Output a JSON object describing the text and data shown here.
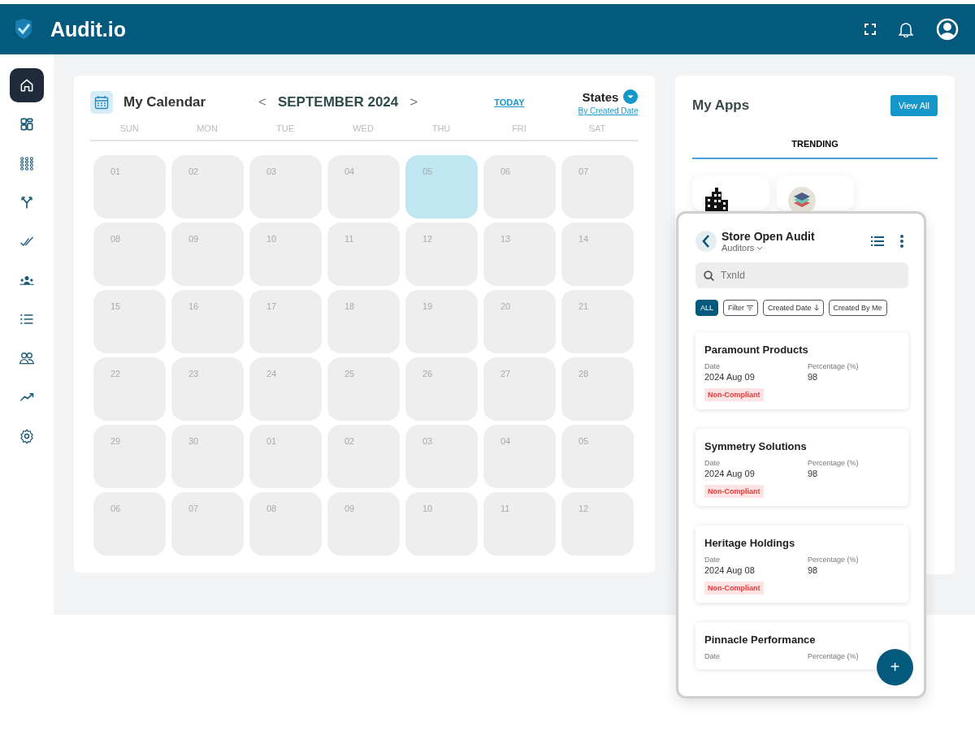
{
  "header": {
    "brand": "Audit.io"
  },
  "sidebar": {
    "items": [
      {
        "selected": true
      },
      {
        "selected": false
      },
      {
        "selected": false
      },
      {
        "selected": false
      },
      {
        "selected": false
      },
      {
        "selected": false
      },
      {
        "selected": false
      },
      {
        "selected": false
      },
      {
        "selected": false
      },
      {
        "selected": false
      }
    ]
  },
  "calendar": {
    "title": "My Calendar",
    "prev": "<",
    "month": "SEPTEMBER 2024",
    "next": ">",
    "today_link": "TODAY",
    "states_label": "States",
    "states_sub": "By Created Date",
    "weekdays": [
      "SUN",
      "MON",
      "TUE",
      "WED",
      "THU",
      "FRI",
      "SAT"
    ],
    "days": [
      {
        "label": "01",
        "selected": false
      },
      {
        "label": "02",
        "selected": false
      },
      {
        "label": "03",
        "selected": false
      },
      {
        "label": "04",
        "selected": false
      },
      {
        "label": "05",
        "selected": true
      },
      {
        "label": "06",
        "selected": false
      },
      {
        "label": "07",
        "selected": false
      },
      {
        "label": "08",
        "selected": false
      },
      {
        "label": "09",
        "selected": false
      },
      {
        "label": "10",
        "selected": false
      },
      {
        "label": "11",
        "selected": false
      },
      {
        "label": "12",
        "selected": false
      },
      {
        "label": "13",
        "selected": false
      },
      {
        "label": "14",
        "selected": false
      },
      {
        "label": "15",
        "selected": false
      },
      {
        "label": "16",
        "selected": false
      },
      {
        "label": "17",
        "selected": false
      },
      {
        "label": "18",
        "selected": false
      },
      {
        "label": "19",
        "selected": false
      },
      {
        "label": "20",
        "selected": false
      },
      {
        "label": "21",
        "selected": false
      },
      {
        "label": "22",
        "selected": false
      },
      {
        "label": "23",
        "selected": false
      },
      {
        "label": "24",
        "selected": false
      },
      {
        "label": "25",
        "selected": false
      },
      {
        "label": "26",
        "selected": false
      },
      {
        "label": "27",
        "selected": false
      },
      {
        "label": "28",
        "selected": false
      },
      {
        "label": "29",
        "selected": false
      },
      {
        "label": "30",
        "selected": false
      },
      {
        "label": "01",
        "selected": false
      },
      {
        "label": "02",
        "selected": false
      },
      {
        "label": "03",
        "selected": false
      },
      {
        "label": "04",
        "selected": false
      },
      {
        "label": "05",
        "selected": false
      },
      {
        "label": "06",
        "selected": false
      },
      {
        "label": "07",
        "selected": false
      },
      {
        "label": "08",
        "selected": false
      },
      {
        "label": "09",
        "selected": false
      },
      {
        "label": "10",
        "selected": false
      },
      {
        "label": "11",
        "selected": false
      },
      {
        "label": "12",
        "selected": false
      }
    ]
  },
  "apps": {
    "title": "My Apps",
    "view_all": "View All",
    "tabs": [
      {
        "label": "TRENDING",
        "selected": true
      }
    ]
  },
  "mobile": {
    "title": "Store Open Audit",
    "subtitle": "Auditors",
    "search": {
      "placeholder": "TxnId"
    },
    "chips": [
      {
        "label": "ALL",
        "kind": "plain",
        "selected": true
      },
      {
        "label": "Filter",
        "kind": "filter",
        "selected": false
      },
      {
        "label": "Created Date",
        "kind": "sort",
        "selected": false
      },
      {
        "label": "Created By Me",
        "kind": "plain",
        "selected": false
      }
    ],
    "records": [
      {
        "name": "Paramount Products",
        "date_label": "Date",
        "date": "2024 Aug 09",
        "percentage_label": "Percentage (%)",
        "percentage": "98",
        "status": "Non-Compliant"
      },
      {
        "name": "Symmetry Solutions",
        "date_label": "Date",
        "date": "2024 Aug 09",
        "percentage_label": "Percentage (%)",
        "percentage": "98",
        "status": "Non-Compliant"
      },
      {
        "name": "Heritage Holdings",
        "date_label": "Date",
        "date": "2024 Aug 08",
        "percentage_label": "Percentage (%)",
        "percentage": "98",
        "status": "Non-Compliant"
      },
      {
        "name": "Pinnacle Performance",
        "date_label": "Date",
        "percentage_label": "Percentage (%)"
      }
    ],
    "fab": "+"
  }
}
